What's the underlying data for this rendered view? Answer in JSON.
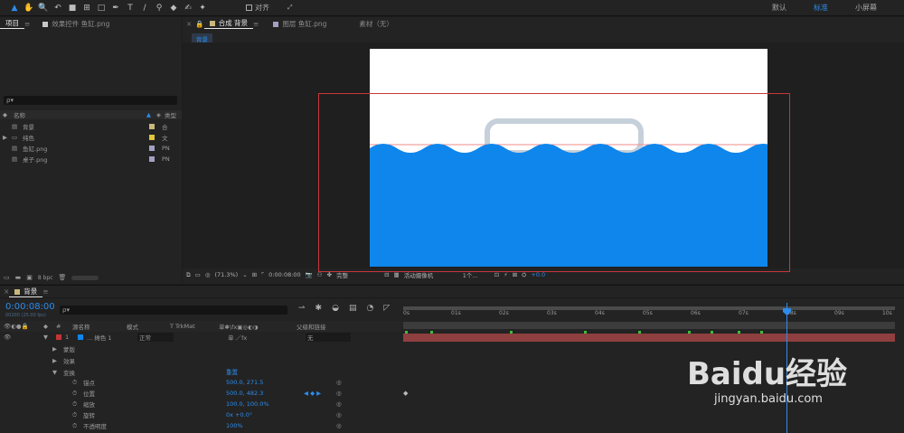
{
  "toolbar": {
    "tools": [
      {
        "icon": "selection-icon",
        "glyph": "▲",
        "active": true
      },
      {
        "icon": "hand-icon",
        "glyph": "✋",
        "active": false
      },
      {
        "icon": "zoom-icon",
        "glyph": "🔍",
        "active": false
      },
      {
        "icon": "rotate-icon",
        "glyph": "↶",
        "active": false
      },
      {
        "icon": "camera-icon",
        "glyph": "■",
        "active": false
      },
      {
        "icon": "pan-behind-icon",
        "glyph": "⊞",
        "active": false
      },
      {
        "icon": "rectangle-icon",
        "glyph": "□",
        "active": false
      },
      {
        "icon": "pen-icon",
        "glyph": "✒",
        "active": false
      },
      {
        "icon": "text-icon",
        "glyph": "T",
        "active": false
      },
      {
        "icon": "brush-icon",
        "glyph": "/",
        "active": false
      },
      {
        "icon": "stamp-icon",
        "glyph": "⚲",
        "active": false
      },
      {
        "icon": "eraser-icon",
        "glyph": "◆",
        "active": false
      },
      {
        "icon": "roto-brush-icon",
        "glyph": "✍",
        "active": false
      },
      {
        "icon": "puppet-icon",
        "glyph": "✦",
        "active": false
      }
    ],
    "align_label": "对齐",
    "workspaces": [
      "默认",
      "标准",
      "小屏幕"
    ],
    "active_workspace": "标准"
  },
  "project_panel": {
    "tabs": [
      "项目",
      "效果控件 鱼缸.png"
    ],
    "search_placeholder": "ρ▾",
    "col_name": "名称",
    "col_type": "类型",
    "items": [
      {
        "name": "背景",
        "type": "合",
        "color": "#c8b87a",
        "icon": "composition-icon"
      },
      {
        "name": "纯色",
        "type": "文",
        "color": "#e3c43b",
        "icon": "folder-icon"
      },
      {
        "name": "鱼缸.png",
        "type": "PN",
        "color": "#a3a0c4",
        "icon": "file-icon"
      },
      {
        "name": "桌子.png",
        "type": "PN",
        "color": "#a3a0c4",
        "icon": "file-icon"
      }
    ],
    "bpc": "8 bpc"
  },
  "comp_panel": {
    "tabs": [
      "合成 背景",
      "图层 鱼缸.png",
      "素材（无）"
    ],
    "breadcrumb": "背景",
    "zoom": "(71.3%)",
    "timecode": "0:00:08:00",
    "resolution": "完整",
    "camera": "活动摄像机",
    "views": "1个...",
    "exposure": "+0.0"
  },
  "timeline": {
    "tab": "背景",
    "timecode": "0:00:08:00",
    "sub_timecode": "00200 (25.00 fps)",
    "search_placeholder": "ρ▾",
    "headers": {
      "num": "#",
      "source": "源名称",
      "mode": "模式",
      "trkmat": "T  TrkMat",
      "switches": "单✱\\fx▣◎◐◑",
      "parent": "父级和链接"
    },
    "layer": {
      "num": "1",
      "name": "... 摊色 1",
      "mode": "正常",
      "parent": "无"
    },
    "groups": [
      "蒙版",
      "效果",
      "变换"
    ],
    "reset_label": "重置",
    "properties": [
      {
        "name": "锚点",
        "value": "500.0, 271.5"
      },
      {
        "name": "位置",
        "value": "500.0, 482.3"
      },
      {
        "name": "缩放",
        "value": "100.0, 100.0%"
      },
      {
        "name": "旋转",
        "value": "0x +0.0°"
      },
      {
        "name": "不透明度",
        "value": "100%"
      }
    ],
    "ruler": [
      "0s",
      "01s",
      "02s",
      "03s",
      "04s",
      "05s",
      "06s",
      "07s",
      "08s",
      "09s",
      "10s"
    ],
    "playhead_seconds": 8
  },
  "watermark": {
    "brand": "Baidu经验",
    "url": "jingyan.baidu.com"
  }
}
